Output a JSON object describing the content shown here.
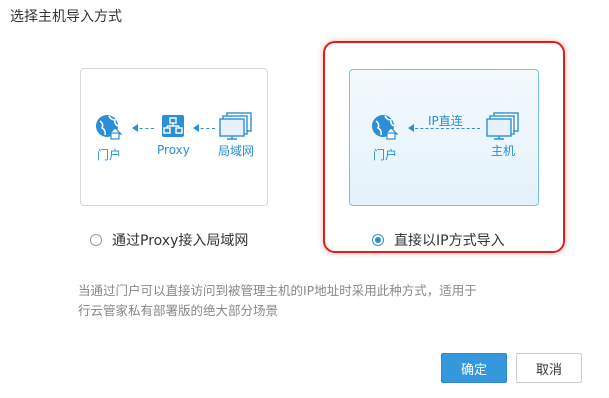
{
  "dialog": {
    "title": "选择主机导入方式"
  },
  "options": [
    {
      "label": "通过Proxy接入局域网",
      "selected": false,
      "diagram": {
        "portal": "门户",
        "proxy": "Proxy",
        "lan": "局域网"
      }
    },
    {
      "label": "直接以IP方式导入",
      "selected": true,
      "diagram": {
        "portal": "门户",
        "link": "IP直连",
        "host": "主机"
      }
    }
  ],
  "description": {
    "line1": "当通过门户可以直接访问到被管理主机的IP地址时采用此种方式，适用于",
    "line2": "行云管家私有部署版的绝大部分场景"
  },
  "buttons": {
    "ok": "确定",
    "cancel": "取消"
  },
  "colors": {
    "accent": "#2a8fd6",
    "primary_button": "#3598dc",
    "highlight": "#e21b1b"
  }
}
